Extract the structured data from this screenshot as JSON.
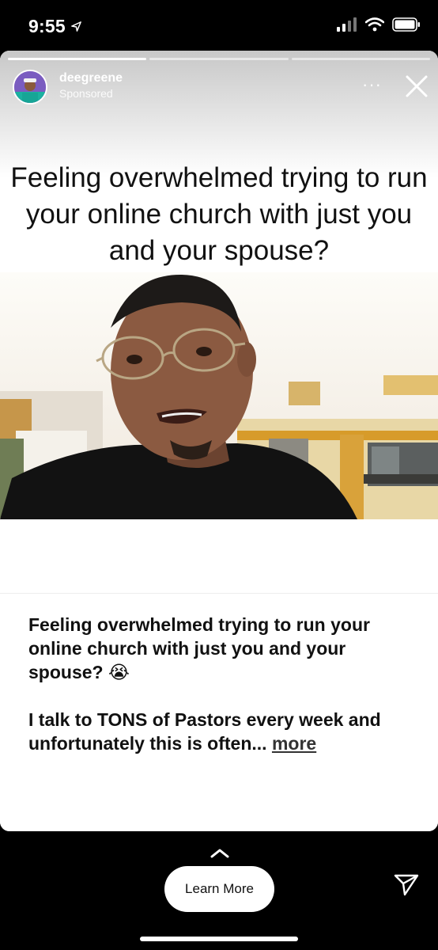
{
  "status_bar": {
    "time": "9:55",
    "icons": [
      "location-arrow-icon",
      "signal-icon",
      "wifi-icon",
      "battery-icon"
    ]
  },
  "story": {
    "progress": [
      1.0,
      0.0,
      0.0
    ],
    "username": "deegreene",
    "sponsored_label": "Sponsored",
    "more_label": "···",
    "headline": "Feeling overwhelmed trying to run your online church with just you and your spouse?"
  },
  "caption": {
    "line1": "Feeling overwhelmed trying to run your online church with just you and your spouse? 😭",
    "line2": "I talk to TONS of Pastors every week and unfortunately this is often...",
    "more_link": "more"
  },
  "cta": {
    "label": "Learn More"
  },
  "colors": {
    "background": "#000000",
    "card": "#ffffff",
    "text": "#111111"
  }
}
